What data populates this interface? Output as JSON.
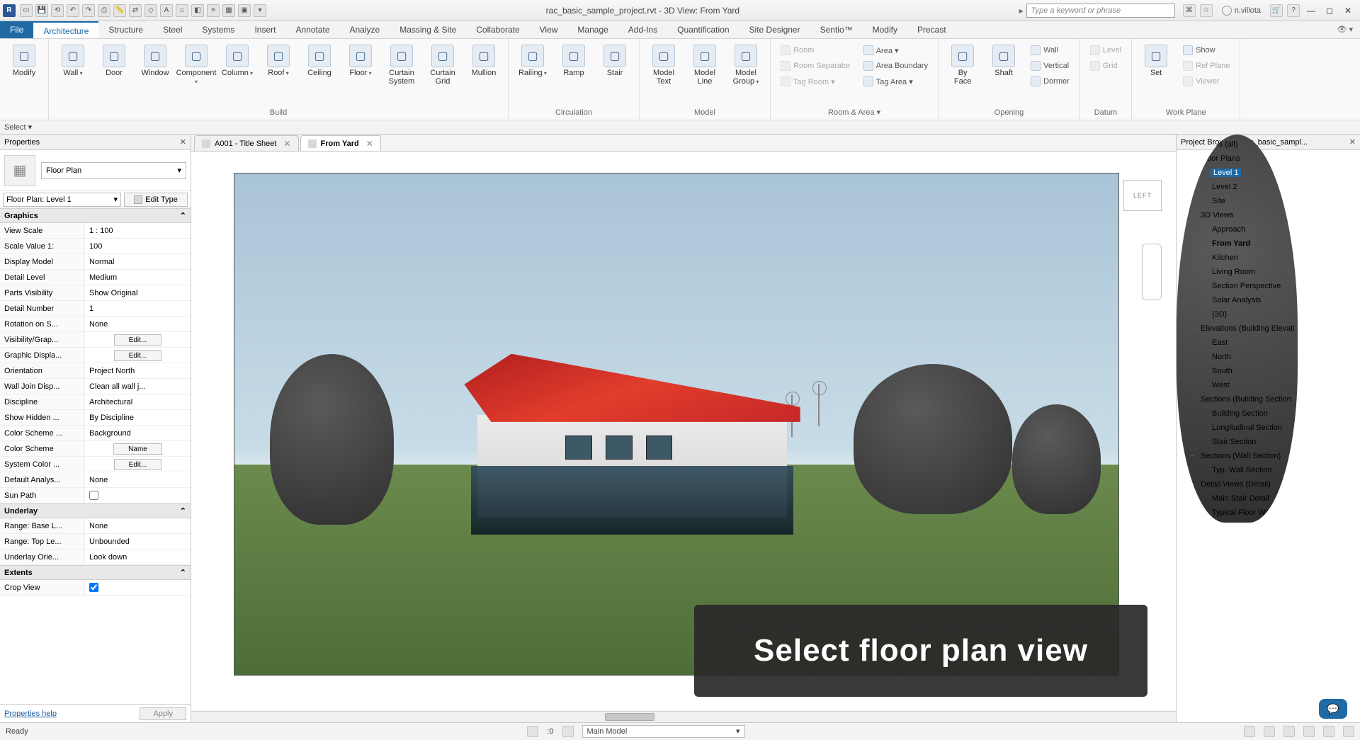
{
  "titlebar": {
    "doc_title": "rac_basic_sample_project.rvt - 3D View: From Yard",
    "search_placeholder": "Type a keyword or phrase",
    "user": "n.villota"
  },
  "menu_tabs": [
    "File",
    "Architecture",
    "Structure",
    "Steel",
    "Systems",
    "Insert",
    "Annotate",
    "Analyze",
    "Massing & Site",
    "Collaborate",
    "View",
    "Manage",
    "Add-Ins",
    "Quantification",
    "Site Designer",
    "Sentio™",
    "Modify",
    "Precast"
  ],
  "menu_active": "Architecture",
  "select_label": "Select ▾",
  "ribbon": {
    "groups": [
      {
        "label": "",
        "tools": [
          {
            "l": "Modify",
            "dd": false
          }
        ]
      },
      {
        "label": "Build",
        "tools": [
          {
            "l": "Wall",
            "dd": true
          },
          {
            "l": "Door"
          },
          {
            "l": "Window"
          },
          {
            "l": "Component",
            "dd": true
          },
          {
            "l": "Column",
            "dd": true
          },
          {
            "l": "Roof",
            "dd": true
          },
          {
            "l": "Ceiling"
          },
          {
            "l": "Floor",
            "dd": true
          },
          {
            "l": "Curtain System"
          },
          {
            "l": "Curtain Grid"
          },
          {
            "l": "Mullion"
          }
        ]
      },
      {
        "label": "Circulation",
        "tools": [
          {
            "l": "Railing",
            "dd": true
          },
          {
            "l": "Ramp"
          },
          {
            "l": "Stair"
          }
        ]
      },
      {
        "label": "Model",
        "tools": [
          {
            "l": "Model Text"
          },
          {
            "l": "Model Line"
          },
          {
            "l": "Model Group",
            "dd": true
          }
        ]
      },
      {
        "label": "Room & Area ▾",
        "tools_small": [
          [
            {
              "l": "Room",
              "dis": true
            },
            {
              "l": "Room Separator",
              "dis": true
            },
            {
              "l": "Tag Room ▾",
              "dis": true
            }
          ],
          [
            {
              "l": "Area ▾"
            },
            {
              "l": "Area Boundary"
            },
            {
              "l": "Tag Area ▾"
            }
          ]
        ]
      },
      {
        "label": "Opening",
        "tools": [
          {
            "l": "By Face"
          },
          {
            "l": "Shaft"
          }
        ],
        "tools_small": [
          [
            {
              "l": "Wall"
            },
            {
              "l": "Vertical"
            },
            {
              "l": "Dormer"
            }
          ]
        ]
      },
      {
        "label": "Datum",
        "tools_small": [
          [
            {
              "l": "Level",
              "dis": true
            },
            {
              "l": "Grid",
              "dis": true
            }
          ]
        ]
      },
      {
        "label": "Work Plane",
        "tools": [
          {
            "l": "Set"
          }
        ],
        "tools_small": [
          [
            {
              "l": "Show"
            },
            {
              "l": "Ref Plane",
              "dis": true
            },
            {
              "l": "Viewer",
              "dis": true
            }
          ]
        ]
      }
    ]
  },
  "props": {
    "panel_title": "Properties",
    "type_name": "Floor Plan",
    "instance": "Floor Plan: Level 1",
    "edit_type": "Edit Type",
    "sections": [
      {
        "title": "Graphics",
        "rows": [
          {
            "k": "View Scale",
            "v": "1 : 100"
          },
          {
            "k": "Scale Value  1:",
            "v": "100"
          },
          {
            "k": "Display Model",
            "v": "Normal"
          },
          {
            "k": "Detail Level",
            "v": "Medium"
          },
          {
            "k": "Parts Visibility",
            "v": "Show Original"
          },
          {
            "k": "Detail Number",
            "v": "1"
          },
          {
            "k": "Rotation on S...",
            "v": "None"
          },
          {
            "k": "Visibility/Grap...",
            "btn": "Edit..."
          },
          {
            "k": "Graphic Displa...",
            "btn": "Edit..."
          },
          {
            "k": "Orientation",
            "v": "Project North"
          },
          {
            "k": "Wall Join Disp...",
            "v": "Clean all wall j..."
          },
          {
            "k": "Discipline",
            "v": "Architectural"
          },
          {
            "k": "Show Hidden ...",
            "v": "By Discipline"
          },
          {
            "k": "Color Scheme ...",
            "v": "Background"
          },
          {
            "k": "Color Scheme",
            "btn": "Name"
          },
          {
            "k": "System Color ...",
            "btn": "Edit..."
          },
          {
            "k": "Default Analys...",
            "v": "None"
          },
          {
            "k": "Sun Path",
            "chk": false
          }
        ]
      },
      {
        "title": "Underlay",
        "rows": [
          {
            "k": "Range: Base L...",
            "v": "None"
          },
          {
            "k": "Range: Top Le...",
            "v": "Unbounded"
          },
          {
            "k": "Underlay Orie...",
            "v": "Look down"
          }
        ]
      },
      {
        "title": "Extents",
        "rows": [
          {
            "k": "Crop View",
            "chk": true
          }
        ]
      }
    ],
    "help": "Properties help",
    "apply": "Apply"
  },
  "viewtabs": [
    {
      "label": "A001 - Title Sheet",
      "active": false
    },
    {
      "label": "From Yard",
      "active": true
    }
  ],
  "viewcube": "LEFT",
  "tooltip": "Select  floor plan view",
  "browser": {
    "panel_title": "Project Browser - rac_basic_sampl...",
    "tree": [
      {
        "d": 0,
        "tw": "−",
        "icon": true,
        "l": "Views (all)"
      },
      {
        "d": 1,
        "tw": "−",
        "l": "Floor Plans"
      },
      {
        "d": 2,
        "l": "Level 1",
        "sel": true
      },
      {
        "d": 2,
        "l": "Level 2"
      },
      {
        "d": 2,
        "l": "Site"
      },
      {
        "d": 1,
        "tw": "−",
        "l": "3D Views"
      },
      {
        "d": 2,
        "l": "Approach"
      },
      {
        "d": 2,
        "l": "From Yard",
        "bold": true
      },
      {
        "d": 2,
        "l": "Kitchen"
      },
      {
        "d": 2,
        "l": "Living Room"
      },
      {
        "d": 2,
        "l": "Section Perspective"
      },
      {
        "d": 2,
        "l": "Solar Analysis"
      },
      {
        "d": 2,
        "l": "{3D}"
      },
      {
        "d": 1,
        "tw": "−",
        "l": "Elevations (Building Elevati"
      },
      {
        "d": 2,
        "l": "East"
      },
      {
        "d": 2,
        "l": "North"
      },
      {
        "d": 2,
        "l": "South"
      },
      {
        "d": 2,
        "l": "West"
      },
      {
        "d": 1,
        "tw": "−",
        "l": "Sections (Building Section"
      },
      {
        "d": 2,
        "l": "Building Section"
      },
      {
        "d": 2,
        "l": "Longitudinal Section"
      },
      {
        "d": 2,
        "l": "Stair Section"
      },
      {
        "d": 1,
        "tw": "−",
        "l": "Sections (Wall Section)"
      },
      {
        "d": 2,
        "l": "Typ. Wall Section"
      },
      {
        "d": 1,
        "tw": "−",
        "l": "Detail Views (Detail)"
      },
      {
        "d": 2,
        "l": "Main Stair Detail"
      },
      {
        "d": 2,
        "l": "Typical Floor Wall Conn"
      }
    ]
  },
  "status": {
    "ready": "Ready",
    "workset": "Main Model",
    "coord": ":0"
  }
}
